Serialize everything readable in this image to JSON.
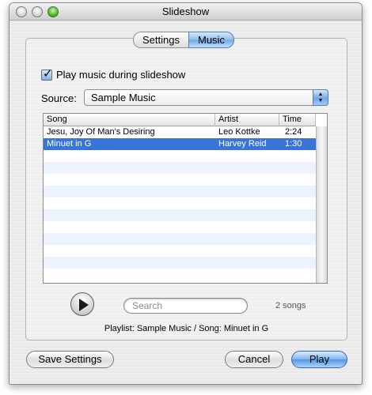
{
  "window": {
    "title": "Slideshow"
  },
  "tabs": [
    {
      "label": "Settings",
      "active": false
    },
    {
      "label": "Music",
      "active": true
    }
  ],
  "music": {
    "play_music_label": "Play music during slideshow",
    "play_music_checked": true,
    "source_label": "Source:",
    "source_value": "Sample Music"
  },
  "table": {
    "columns": [
      "Song",
      "Artist",
      "Time"
    ],
    "rows": [
      {
        "song": "Jesu, Joy Of Man's Desiring",
        "artist": "Leo Kottke",
        "time": "2:24",
        "selected": false
      },
      {
        "song": "Minuet in G",
        "artist": "Harvey Reid",
        "time": "1:30",
        "selected": true
      }
    ]
  },
  "search": {
    "placeholder": "Search",
    "value": ""
  },
  "song_count": "2 songs",
  "status": "Playlist: Sample Music / Song: Minuet in G",
  "buttons": {
    "save_settings": "Save Settings",
    "cancel": "Cancel",
    "play": "Play"
  },
  "colors": {
    "selection": "#3875d7",
    "alt_row": "#edf3fe",
    "accent": "#6fa8e3"
  }
}
